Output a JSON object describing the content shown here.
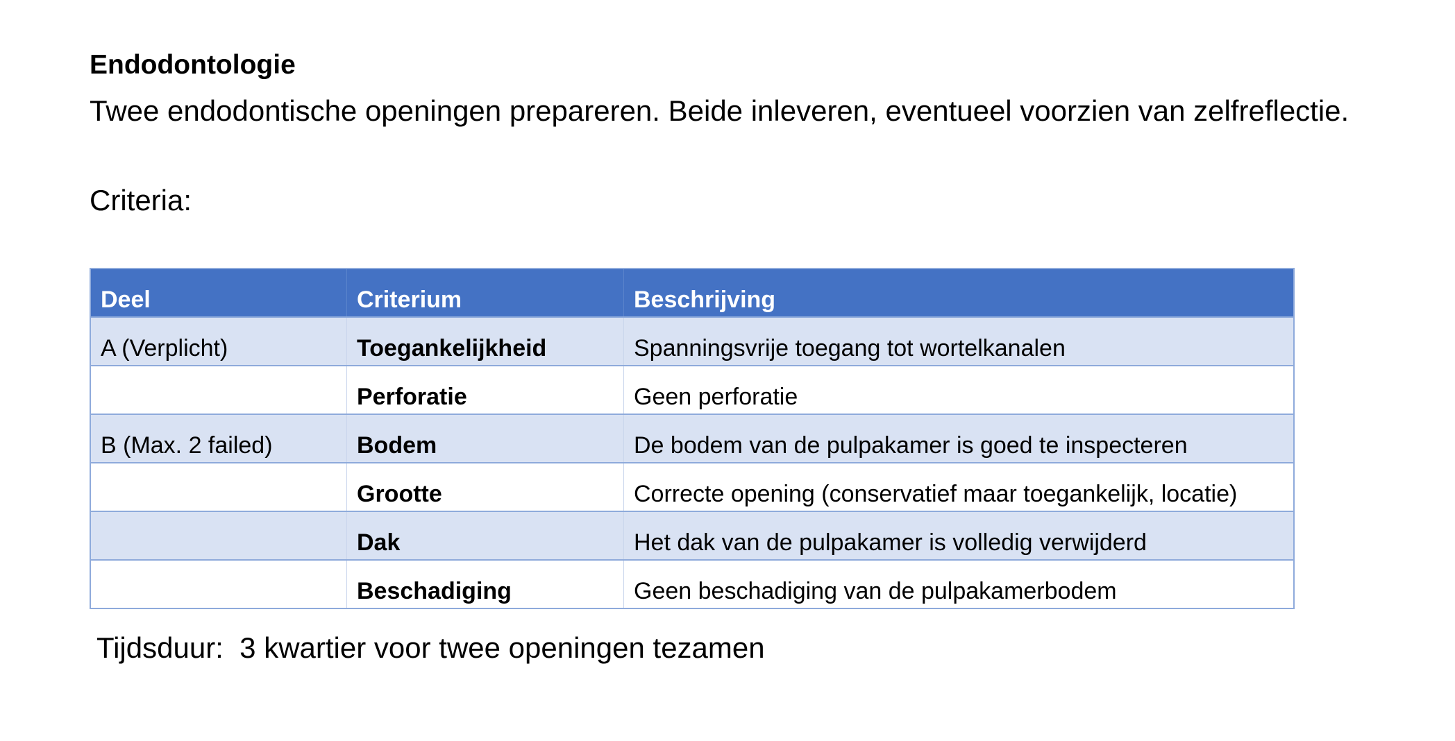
{
  "document": {
    "title": "Endodontologie",
    "intro": "Twee endodontische openingen prepareren. Beide inleveren, eventueel voorzien van zelfreflectie.",
    "criteria_label": "Criteria:",
    "table": {
      "headers": [
        "Deel",
        "Criterium",
        "Beschrijving"
      ],
      "rows": [
        {
          "deel": "A (Verplicht)",
          "criterium": "Toegankelijkheid",
          "beschrijving": "Spanningsvrije toegang tot wortelkanalen"
        },
        {
          "deel": "",
          "criterium": "Perforatie",
          "beschrijving": "Geen perforatie"
        },
        {
          "deel": "B (Max. 2 failed)",
          "criterium": "Bodem",
          "beschrijving": "De bodem van de pulpakamer is goed te inspecteren"
        },
        {
          "deel": "",
          "criterium": "Grootte",
          "beschrijving": "Correcte opening (conservatief maar toegankelijk, locatie)"
        },
        {
          "deel": "",
          "criterium": "Dak",
          "beschrijving": "Het dak van de pulpakamer is volledig verwijderd"
        },
        {
          "deel": "",
          "criterium": "Beschadiging",
          "beschrijving": "Geen beschadiging van de pulpakamerbodem"
        }
      ]
    },
    "duration": "Tijdsduur:  3 kwartier voor twee openingen tezamen"
  },
  "colors": {
    "header_bg": "#4472c4",
    "band_bg": "#d9e2f3",
    "border": "#8eaadb"
  }
}
